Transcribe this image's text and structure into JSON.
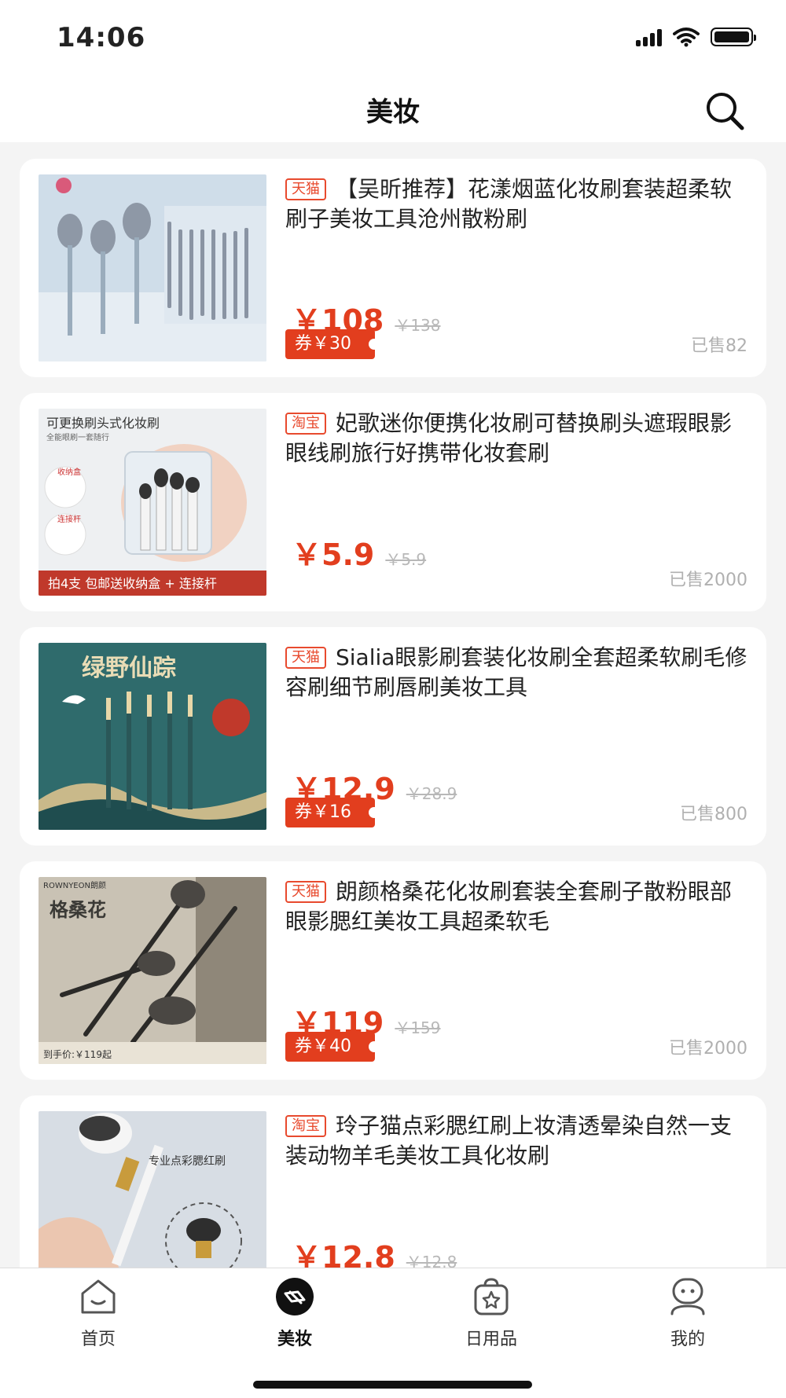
{
  "status_bar": {
    "time": "14:06"
  },
  "header": {
    "title": "美妆"
  },
  "products": [
    {
      "platform": "天猫",
      "title": "【吴昕推荐】花漾烟蓝化妆刷套装超柔软刷子美妆工具沧州散粉刷",
      "price": "￥108",
      "original_price": "￥138",
      "coupon": "券￥30",
      "sold": "已售82"
    },
    {
      "platform": "淘宝",
      "title": "妃歌迷你便携化妆刷可替换刷头遮瑕眼影眼线刷旅行好携带化妆套刷",
      "price": "￥5.9",
      "original_price": "￥5.9",
      "coupon": null,
      "sold": "已售2000",
      "image_text": {
        "headline": "可更换刷头式化妆刷",
        "sub": "全能眼刷一套随行",
        "box_label": "收纳盒",
        "rod_label": "连接杆",
        "banner": "拍4支 包邮送收纳盒 + 连接杆"
      }
    },
    {
      "platform": "天猫",
      "title": "Sialia眼影刷套装化妆刷全套超柔软刷毛修容刷细节刷唇刷美妆工具",
      "price": "￥12.9",
      "original_price": "￥28.9",
      "coupon": "券￥16",
      "sold": "已售800",
      "image_text": {
        "headline": "绿野仙踪"
      }
    },
    {
      "platform": "天猫",
      "title": "朗颜格桑花化妆刷套装全套刷子散粉眼部眼影腮红美妆工具超柔软毛",
      "price": "￥119",
      "original_price": "￥159",
      "coupon": "券￥40",
      "sold": "已售2000",
      "image_text": {
        "brand": "ROWNYEON朗颜",
        "headline": "格桑花",
        "price_tag": "到手价:￥119起"
      }
    },
    {
      "platform": "淘宝",
      "title": "玲子猫点彩腮红刷上妆清透晕染自然一支装动物羊毛美妆工具化妆刷",
      "price": "￥12.8",
      "original_price": "￥12.8",
      "coupon": null,
      "sold": "",
      "image_text": {
        "headline": "专业点彩腮红刷"
      }
    }
  ],
  "tabbar": {
    "items": [
      {
        "label": "首页",
        "icon": "home-icon"
      },
      {
        "label": "美妆",
        "icon": "beauty-icon",
        "active": true
      },
      {
        "label": "日用品",
        "icon": "star-bag-icon"
      },
      {
        "label": "我的",
        "icon": "profile-icon"
      }
    ]
  },
  "colors": {
    "accent": "#e23e1e",
    "tag_border": "#e84a2e",
    "background": "#f4f4f4"
  }
}
